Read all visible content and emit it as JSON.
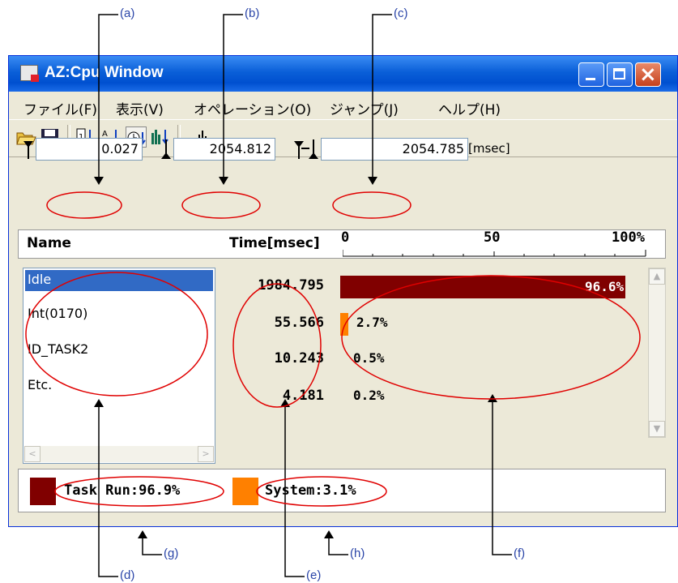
{
  "window": {
    "title": "AZ:Cpu Window"
  },
  "menu": [
    "ファイル(F)",
    "表示(V)",
    "オペレーション(O)",
    "ジャンプ(J)",
    "ヘルプ(H)"
  ],
  "toolbar": [
    "open-icon",
    "save-icon",
    "sort-number-icon",
    "sort-alpha-icon",
    "sort-time-icon",
    "sort-graph-icon",
    "graph-icon"
  ],
  "range": {
    "start": "0.027",
    "end": "2054.812",
    "span": "2054.785",
    "unit": "[msec]"
  },
  "table_header": {
    "name": "Name",
    "time": "Time[msec]",
    "scale": [
      "0",
      "50",
      "100%"
    ]
  },
  "rows": [
    {
      "name": "Idle",
      "time": "1984.795",
      "percent": "96.6%",
      "value": 96.6,
      "color": "#800000"
    },
    {
      "name": "Int(0170)",
      "time": "55.566",
      "percent": "2.7%",
      "value": 2.7,
      "color": "#ff8000"
    },
    {
      "name": "ID_TASK2",
      "time": "10.243",
      "percent": "0.5%",
      "value": 0.5,
      "color": "#ff8000"
    },
    {
      "name": "Etc.",
      "time": "4.181",
      "percent": "0.2%",
      "value": 0.2,
      "color": "#ff8000"
    }
  ],
  "status": {
    "task_run": "Task Run:96.9%",
    "task_color": "#800000",
    "system": "System:3.1%",
    "system_color": "#ff8000"
  },
  "annotations": [
    "(a)",
    "(b)",
    "(c)",
    "(d)",
    "(e)",
    "(f)",
    "(g)",
    "(h)"
  ]
}
